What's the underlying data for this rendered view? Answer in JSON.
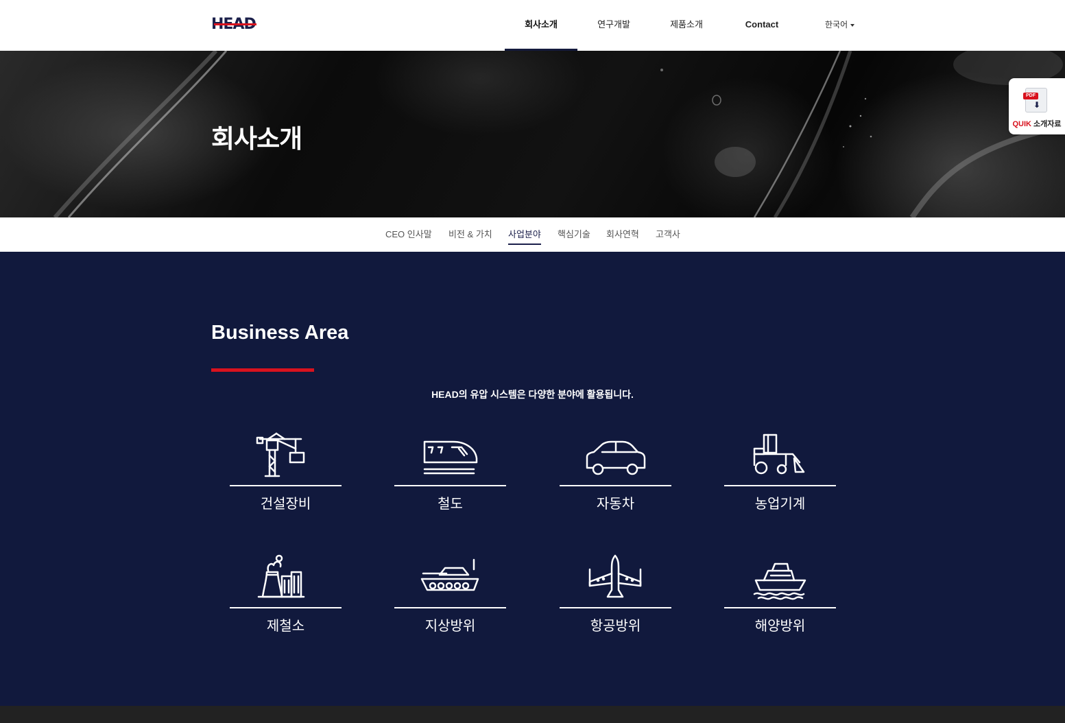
{
  "header": {
    "logo_text": "HEAD",
    "nav": [
      {
        "label": "회사소개"
      },
      {
        "label": "연구개발"
      },
      {
        "label": "제품소개"
      },
      {
        "label": "Contact"
      }
    ],
    "language": "한국어"
  },
  "hero": {
    "title": "회사소개"
  },
  "pdf_badge": {
    "tag": "PDF",
    "label_brand": "QUIK",
    "label_text": " 소개자료"
  },
  "subnav": [
    {
      "label": "CEO 인사말"
    },
    {
      "label": "비전 & 가치"
    },
    {
      "label": "사업분야"
    },
    {
      "label": "핵심기술"
    },
    {
      "label": "회사연혁"
    },
    {
      "label": "고객사"
    }
  ],
  "business": {
    "title": "Business Area",
    "description": "HEAD의 유압 시스템은 다양한 분야에 활용됩니다.",
    "items": [
      {
        "label": "건설장비",
        "icon": "crane-icon"
      },
      {
        "label": "철도",
        "icon": "train-icon"
      },
      {
        "label": "자동차",
        "icon": "car-icon"
      },
      {
        "label": "농업기계",
        "icon": "tractor-icon"
      },
      {
        "label": "제철소",
        "icon": "steel-mill-icon"
      },
      {
        "label": "지상방위",
        "icon": "tank-icon"
      },
      {
        "label": "항공방위",
        "icon": "fighter-jet-icon"
      },
      {
        "label": "해양방위",
        "icon": "ship-icon"
      }
    ]
  },
  "colors": {
    "navy": "#11193d",
    "accent_red": "#d8121e"
  }
}
